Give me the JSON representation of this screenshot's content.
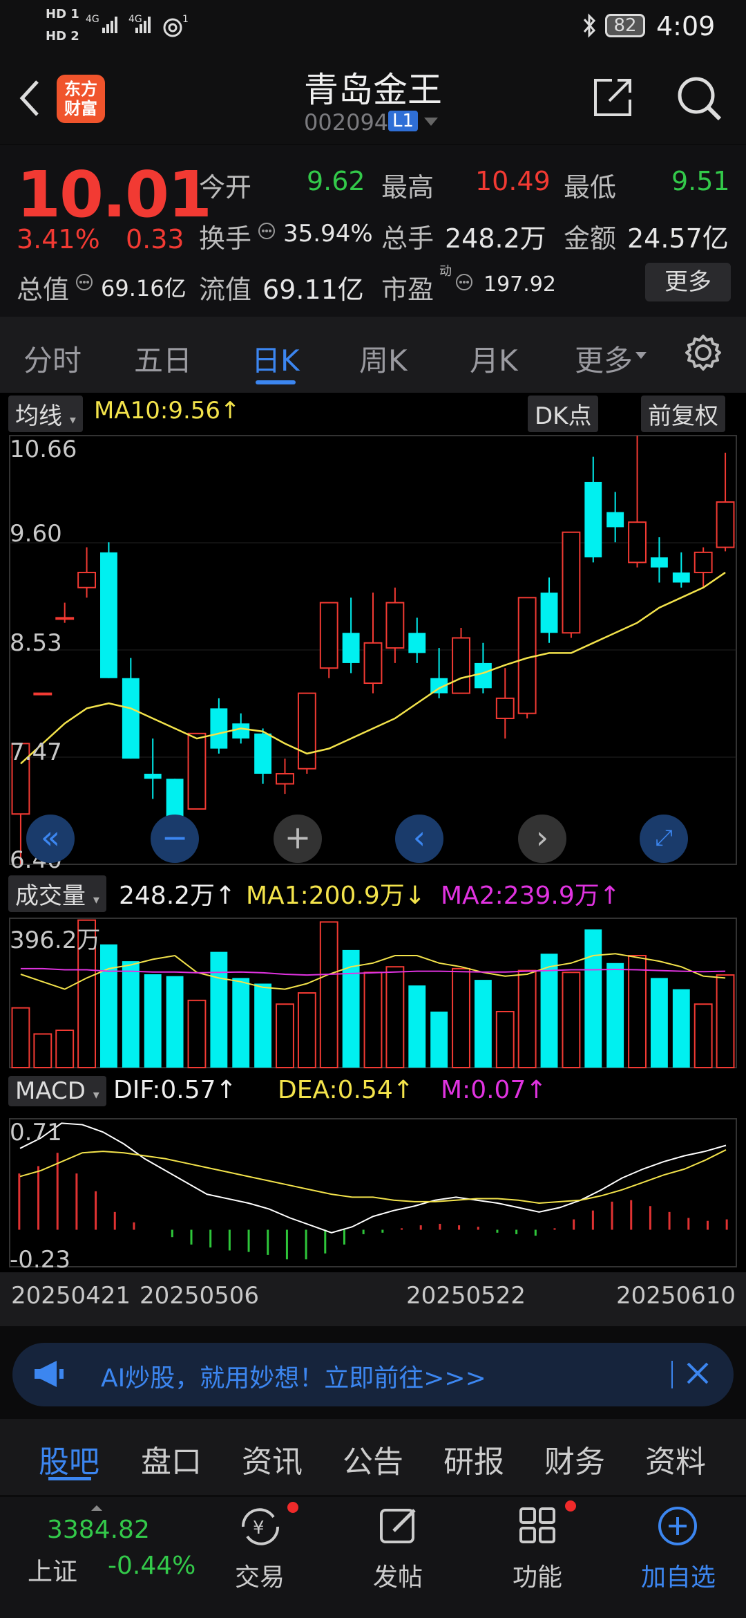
{
  "status": {
    "sim1": "HD 1",
    "sim2": "HD 2",
    "net1": "4G",
    "net2": "4G",
    "hotspot": "1",
    "battery": "82",
    "time": "4:09"
  },
  "header": {
    "title": "青岛金王",
    "code": "002094",
    "level": "L1",
    "logo_line1": "东方",
    "logo_line2": "财富",
    "back_icon": "back-arrow-icon",
    "share_icon": "share-icon",
    "search_icon": "search-icon"
  },
  "quote": {
    "price": "10.01",
    "change_pct": "3.41%",
    "change": "0.33",
    "open_label": "今开",
    "open": "9.62",
    "high_label": "最高",
    "high": "10.49",
    "low_label": "最低",
    "low": "9.51",
    "turnover_label": "换手",
    "turnover": "35.94%",
    "volume_label": "总手",
    "volume": "248.2万",
    "amount_label": "金额",
    "amount": "24.57亿",
    "mktcap_label": "总值",
    "mktcap": "69.16亿",
    "float_label": "流值",
    "float": "69.11亿",
    "pe_label": "市盈",
    "pe_sup": "动",
    "pe": "197.92",
    "more": "更多"
  },
  "tabs": [
    "分时",
    "五日",
    "日K",
    "周K",
    "月K",
    "更多"
  ],
  "chart_controls": {
    "ma_button": "均线",
    "ma10": "MA10:9.56↑",
    "dk_button": "DK点",
    "adjust_button": "前复权",
    "vol_button": "成交量",
    "vol_value": "248.2万↑",
    "vol_ma1": "MA1:200.9万↓",
    "vol_ma2": "MA2:239.9万↑",
    "macd_button": "MACD",
    "dif": "DIF:0.57↑",
    "dea": "DEA:0.54↑",
    "m": "M:0.07↑"
  },
  "colors": {
    "up": "#f23a33",
    "down": "#00f0f0",
    "ma": "#f3e34b",
    "ma2": "#e033e0",
    "macd_up": "#e03232",
    "macd_down": "#2ec63a",
    "accent": "#3c86f0"
  },
  "chart_data": {
    "type": "candlestick",
    "ylim": [
      6.4,
      10.66
    ],
    "yticks": [
      "10.66",
      "9.60",
      "8.53",
      "7.47",
      "6.40"
    ],
    "vol_axis_label": "396.2万",
    "macd_ticks": [
      "0.71",
      "-0.23"
    ],
    "dates": [
      "20250421",
      "20250506",
      "20250522",
      "20250610"
    ],
    "candles": [
      {
        "o": 6.9,
        "c": 7.6,
        "h": 7.6,
        "l": 6.4,
        "v": 160
      },
      {
        "o": 8.1,
        "c": 8.1,
        "h": 8.1,
        "l": 8.1,
        "v": 90
      },
      {
        "o": 8.85,
        "c": 8.85,
        "h": 9.0,
        "l": 8.8,
        "v": 100
      },
      {
        "o": 9.15,
        "c": 9.3,
        "h": 9.55,
        "l": 9.05,
        "v": 395
      },
      {
        "o": 9.5,
        "c": 8.25,
        "h": 9.6,
        "l": 8.25,
        "v": 330
      },
      {
        "o": 8.25,
        "c": 7.45,
        "h": 8.45,
        "l": 7.45,
        "v": 285
      },
      {
        "o": 7.3,
        "c": 7.25,
        "h": 7.65,
        "l": 7.05,
        "v": 250
      },
      {
        "o": 7.25,
        "c": 6.85,
        "h": 7.25,
        "l": 6.85,
        "v": 245
      },
      {
        "o": 6.95,
        "c": 7.7,
        "h": 7.7,
        "l": 6.95,
        "v": 180
      },
      {
        "o": 7.95,
        "c": 7.55,
        "h": 8.05,
        "l": 7.5,
        "v": 310
      },
      {
        "o": 7.8,
        "c": 7.65,
        "h": 7.9,
        "l": 7.6,
        "v": 240
      },
      {
        "o": 7.7,
        "c": 7.3,
        "h": 7.75,
        "l": 7.2,
        "v": 225
      },
      {
        "o": 7.2,
        "c": 7.3,
        "h": 7.45,
        "l": 7.1,
        "v": 170
      },
      {
        "o": 7.35,
        "c": 8.1,
        "h": 8.1,
        "l": 7.3,
        "v": 200
      },
      {
        "o": 8.35,
        "c": 9.0,
        "h": 9.0,
        "l": 8.25,
        "v": 390
      },
      {
        "o": 8.7,
        "c": 8.4,
        "h": 9.05,
        "l": 8.3,
        "v": 315
      },
      {
        "o": 8.2,
        "c": 8.6,
        "h": 9.1,
        "l": 8.1,
        "v": 255
      },
      {
        "o": 8.55,
        "c": 9.0,
        "h": 9.15,
        "l": 8.4,
        "v": 270
      },
      {
        "o": 8.7,
        "c": 8.5,
        "h": 8.85,
        "l": 8.4,
        "v": 220
      },
      {
        "o": 8.25,
        "c": 8.1,
        "h": 8.55,
        "l": 8.05,
        "v": 150
      },
      {
        "o": 8.1,
        "c": 8.65,
        "h": 8.75,
        "l": 8.1,
        "v": 265
      },
      {
        "o": 8.4,
        "c": 8.15,
        "h": 8.6,
        "l": 8.1,
        "v": 235
      },
      {
        "o": 7.85,
        "c": 8.05,
        "h": 8.35,
        "l": 7.65,
        "v": 150
      },
      {
        "o": 7.9,
        "c": 9.05,
        "h": 9.05,
        "l": 7.85,
        "v": 260
      },
      {
        "o": 9.1,
        "c": 8.7,
        "h": 9.25,
        "l": 8.6,
        "v": 305
      },
      {
        "o": 8.7,
        "c": 9.7,
        "h": 9.7,
        "l": 8.65,
        "v": 255
      },
      {
        "o": 10.2,
        "c": 9.45,
        "h": 10.45,
        "l": 9.4,
        "v": 370
      },
      {
        "o": 9.9,
        "c": 9.75,
        "h": 10.1,
        "l": 9.6,
        "v": 280
      },
      {
        "o": 9.4,
        "c": 9.8,
        "h": 10.66,
        "l": 9.35,
        "v": 300
      },
      {
        "o": 9.45,
        "c": 9.35,
        "h": 9.65,
        "l": 9.2,
        "v": 240
      },
      {
        "o": 9.3,
        "c": 9.2,
        "h": 9.5,
        "l": 9.15,
        "v": 210
      },
      {
        "o": 9.3,
        "c": 9.5,
        "h": 9.55,
        "l": 9.15,
        "v": 170
      },
      {
        "o": 9.55,
        "c": 10.0,
        "h": 10.49,
        "l": 9.51,
        "v": 248
      }
    ],
    "ma10": [
      7.4,
      7.6,
      7.8,
      7.95,
      8.0,
      7.95,
      7.85,
      7.75,
      7.65,
      7.7,
      7.75,
      7.72,
      7.6,
      7.5,
      7.55,
      7.65,
      7.75,
      7.85,
      8.0,
      8.15,
      8.25,
      8.3,
      8.38,
      8.45,
      8.5,
      8.5,
      8.6,
      8.7,
      8.8,
      8.95,
      9.05,
      9.15,
      9.3
    ],
    "vol_ma1": [
      250,
      230,
      210,
      240,
      265,
      275,
      290,
      300,
      255,
      240,
      230,
      215,
      210,
      225,
      250,
      270,
      280,
      300,
      300,
      280,
      270,
      255,
      245,
      250,
      270,
      280,
      300,
      305,
      295,
      285,
      270,
      245,
      240
    ],
    "vol_ma2": [
      265,
      265,
      262,
      262,
      258,
      258,
      256,
      256,
      254,
      255,
      256,
      254,
      250,
      248,
      250,
      252,
      254,
      256,
      258,
      258,
      257,
      256,
      256,
      258,
      260,
      262,
      262,
      263,
      262,
      260,
      258,
      257,
      258
    ],
    "dif": [
      0.55,
      0.62,
      0.72,
      0.71,
      0.66,
      0.58,
      0.48,
      0.4,
      0.32,
      0.24,
      0.21,
      0.18,
      0.14,
      0.08,
      0.03,
      -0.02,
      0.02,
      0.09,
      0.13,
      0.16,
      0.2,
      0.22,
      0.2,
      0.18,
      0.15,
      0.12,
      0.15,
      0.2,
      0.27,
      0.35,
      0.41,
      0.46,
      0.5,
      0.53,
      0.57
    ],
    "dea": [
      0.36,
      0.4,
      0.46,
      0.52,
      0.53,
      0.52,
      0.5,
      0.48,
      0.45,
      0.42,
      0.39,
      0.36,
      0.33,
      0.3,
      0.27,
      0.24,
      0.22,
      0.22,
      0.2,
      0.19,
      0.19,
      0.2,
      0.21,
      0.21,
      0.2,
      0.18,
      0.19,
      0.2,
      0.23,
      0.27,
      0.32,
      0.37,
      0.41,
      0.47,
      0.54
    ],
    "macd": [
      0.38,
      0.43,
      0.52,
      0.38,
      0.26,
      0.12,
      0.05,
      0.0,
      -0.05,
      -0.1,
      -0.12,
      -0.14,
      -0.15,
      -0.17,
      -0.2,
      -0.2,
      -0.16,
      -0.1,
      -0.03,
      -0.02,
      0.01,
      0.03,
      0.04,
      0.03,
      0.02,
      -0.02,
      -0.03,
      -0.04,
      0.01,
      0.07,
      0.13,
      0.19,
      0.2,
      0.16,
      0.12,
      0.08,
      0.06,
      0.07
    ]
  },
  "banner": {
    "text": "AI炒股，就用妙想！立即前往>>>"
  },
  "info_tabs": [
    "股吧",
    "盘口",
    "资讯",
    "公告",
    "研报",
    "财务",
    "资料"
  ],
  "bottom": {
    "index_value": "3384.82",
    "index_name": "上证",
    "index_change": "-0.44%",
    "trade": "交易",
    "post": "发帖",
    "func": "功能",
    "add": "加自选"
  }
}
